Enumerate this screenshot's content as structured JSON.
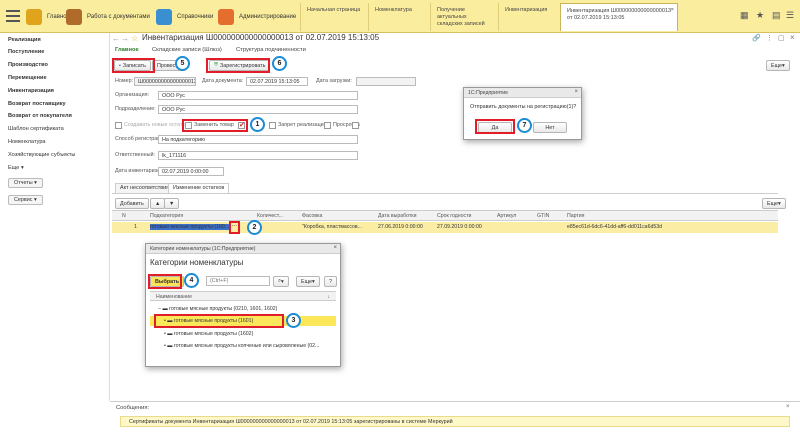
{
  "topbar": {
    "sections": [
      {
        "label": "Главное",
        "icon": "home-icon",
        "color": "#e0a31c"
      },
      {
        "label": "Работа с документами",
        "icon": "briefcase-icon",
        "color": "#b06a2a"
      },
      {
        "label": "Справочники",
        "icon": "books-icon",
        "color": "#3a8fd0"
      },
      {
        "label": "Администрирование",
        "icon": "tools-icon",
        "color": "#e36e2e"
      }
    ],
    "open_tabs": [
      {
        "label": "Начальная страница"
      },
      {
        "label": "Номенклатура"
      },
      {
        "label": "Получение актуальных складских записей"
      },
      {
        "label": "Инвентаризация"
      },
      {
        "label": "Инвентаризация Ш000000000000000013 от 02.07.2019 15:13:05"
      }
    ]
  },
  "sidebar": {
    "items": [
      "Реализация",
      "Поступление",
      "Производство",
      "Перемещение",
      "Инвентаризация",
      "Возврат поставщику",
      "Возврат от покупателя",
      "Шаблон сертификата",
      "Номенклатура",
      "Хозяйствующие субъекты",
      "Еще"
    ],
    "buttons": [
      "Отчеты",
      "Сервис"
    ]
  },
  "doc": {
    "title": "Инвентаризация Ш000000000000000013 от 02.07.2019 15:13:05",
    "nav": [
      "Главное",
      "Складские записи (Шлюз)",
      "Структура подчиненности"
    ],
    "toolbar": {
      "save": "Записать",
      "post": "Провести",
      "register": "Зарегистрировать",
      "more": "Еще"
    },
    "fields": {
      "number_label": "Номер:",
      "number": "Ш000000000000000013",
      "date_label": "Дата документа:",
      "date": "02.07.2019 15:13:05",
      "load_label": "Дата загрузки:",
      "org_label": "Организация:",
      "org": "ООО Рус",
      "dept_label": "Подразделение:",
      "dept": "ООО Рус",
      "create_new": "Создавать новые остатки",
      "replace_goods": "Заменить товар",
      "no_sale": "Запрет реализации",
      "overdue": "Просрочка",
      "reg_method_label": "Способ регистрации:",
      "reg_method": "На подкатегорию",
      "responsible_label": "Ответственный:",
      "responsible": "lk_171116",
      "inv_date_label": "Дата инвентаризации:",
      "inv_date": "02.07.2019  0:00:00"
    },
    "tabs": [
      "Акт несоответствия",
      "Изменение остатков"
    ],
    "grid_toolbar": {
      "add": "Добавить",
      "more": "Еще"
    },
    "grid_headers": [
      "N",
      "Подкатегория",
      "Количест...",
      "Фасовка",
      "Дата выработки",
      "Срок годности",
      "Артикул",
      "GTIN",
      "Партия"
    ],
    "grid_row": {
      "n": "1",
      "subcat": "готовые мясные продукты (160...",
      "pack": "\"Коробка, пластмассов...",
      "prod_date": "27.06.2019 0:00:00",
      "exp_date": "27.09.2019 0:00:00",
      "batch": "e85ec61d-6dc6-41dd-aff6-dd011ca6d53d"
    }
  },
  "confirm": {
    "header": "1С:Предприятие",
    "question": "Отправить документы на регистрацию(1)?",
    "yes": "Да",
    "no": "Нет"
  },
  "picker": {
    "header": "Категории номенклатуры  (1С:Предприятие)",
    "title": "Категории номенклатуры",
    "select": "Выбрать",
    "search_placeholder": "(Ctrl+F)",
    "more": "Еще",
    "help": "?",
    "col": "Наименование",
    "rows": [
      "готовые мясные продукты (0210, 1601, 1602)",
      "готовые мясные продукты (1601)",
      "готовые мясные продукты (1602)",
      "готовые мясные продукты копченые или сыровяленые (02..."
    ]
  },
  "badges": [
    "1",
    "2",
    "3",
    "4",
    "5",
    "6",
    "7"
  ],
  "messages": {
    "header": "Сообщения:",
    "text": "Сертификаты документа Инвентаризация Ш000000000000000013 от 02.07.2019 15:13:05 зарегистрированы в системе Меркурий"
  }
}
